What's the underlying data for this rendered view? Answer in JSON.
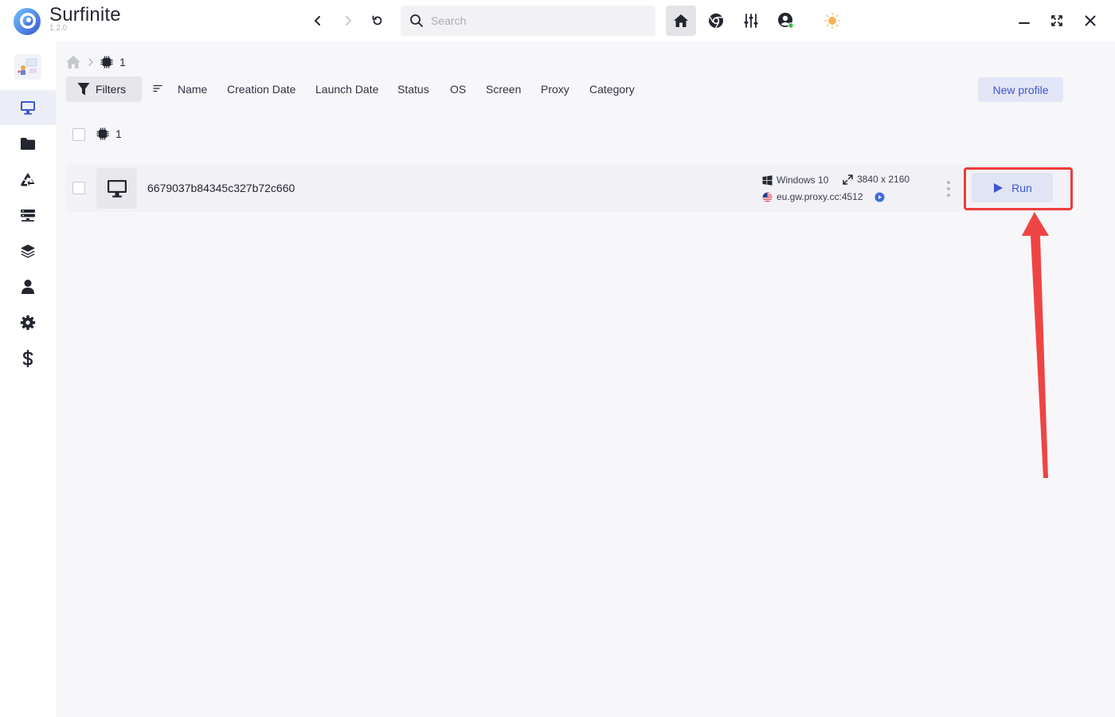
{
  "app": {
    "name": "Surfinite",
    "version": "1.2.0",
    "search_placeholder": "Search"
  },
  "colors": {
    "accent": "#3d57d1",
    "highlight": "#ef3b3b",
    "online": "#2fc43a",
    "sun": "#f6b35b"
  },
  "toolbar": {
    "icons": [
      "back-icon",
      "forward-icon",
      "reload-icon",
      "home-icon",
      "chrome-icon",
      "sliders-icon",
      "account-icon",
      "theme-sun-icon"
    ],
    "window_icons": [
      "minimize-icon",
      "maximize-icon",
      "close-icon"
    ]
  },
  "sidebar": {
    "items": [
      "profiles-icon",
      "folders-icon",
      "trash-icon",
      "proxies-icon",
      "layers-icon",
      "user-icon",
      "settings-icon",
      "billing-icon"
    ],
    "active": "profiles-icon"
  },
  "breadcrumb": {
    "group": "1"
  },
  "filters": {
    "label": "Filters",
    "sort_columns": [
      "Name",
      "Creation Date",
      "Launch Date",
      "Status",
      "OS",
      "Screen",
      "Proxy",
      "Category"
    ]
  },
  "new_profile_label": "New profile",
  "group": {
    "name": "1"
  },
  "profile": {
    "name": "6679037b84345c327b72c660",
    "os": "Windows 10",
    "screen": "3840 x 2160",
    "proxy": "eu.gw.proxy.cc:4512",
    "run_label": "Run"
  }
}
